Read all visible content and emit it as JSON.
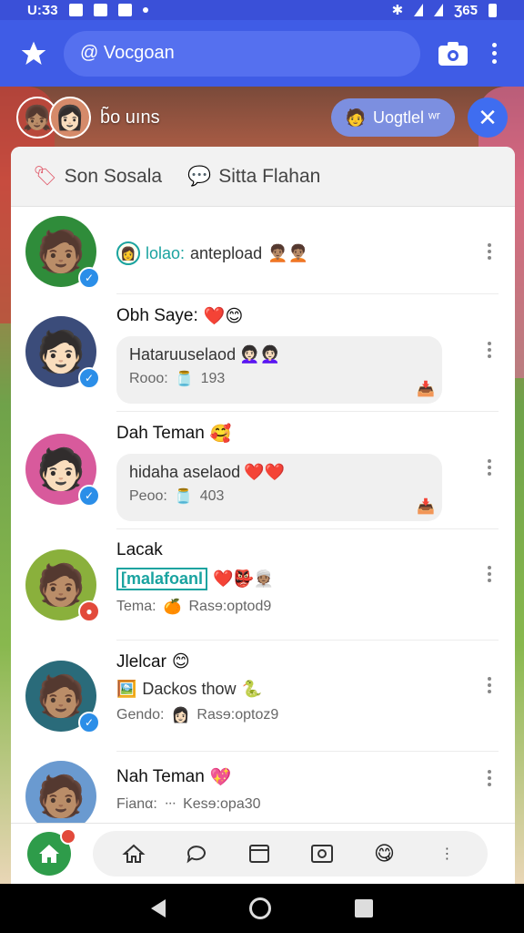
{
  "status_bar": {
    "time": "U:Ӡ3",
    "battery": "Ʒ6Ƽ"
  },
  "app_bar": {
    "search_text": "@ Vocgoan"
  },
  "sub_header": {
    "name": "b̃o uıns",
    "chip_label": "Uogtlel ʷʳ",
    "chip_emoji": "🧑"
  },
  "panel": {
    "title_left": "Son Sosala",
    "title_right": "Sitta Flahan"
  },
  "rows": [
    {
      "avatar": "🧑🏽",
      "avatar_bg": "#2f8c3a",
      "badge_color": "#2b8ee8",
      "line": "lolao:",
      "line_rest": "antepload",
      "emojis": "🧑🏽‍🦱🧑🏽‍🦱"
    },
    {
      "avatar": "🧑🏻",
      "avatar_bg": "#3b4c7a",
      "badge_color": "#2b8ee8",
      "name": "Obh Saye:",
      "name_emoji": "❤️😊",
      "bubble_l1": "Hataruuselaod",
      "bubble_l1_emoji": "👩🏻‍🦱👩🏻‍🦱",
      "bubble_l2_label": "Rooo:",
      "bubble_l2_value": "193",
      "bubble_l2_emoji": "🫙"
    },
    {
      "avatar": "🧑🏻",
      "avatar_bg": "#d85a9c",
      "badge_color": "#2b8ee8",
      "name": "Dah Teman",
      "name_emoji": "🥰",
      "bubble_l1": "hidaha aselaod",
      "bubble_l1_emoji": "❤️❤️",
      "bubble_l2_label": "Peoo:",
      "bubble_l2_value": "403",
      "bubble_l2_emoji": "🫙"
    },
    {
      "avatar": "🧑🏽",
      "avatar_bg": "#8ab03c",
      "badge_color": "#e24a3b",
      "name": "Lacak",
      "highlight": "[malafoanl",
      "line_emoji": "❤️👺👳🏽",
      "sub_label": "Tema:",
      "sub_value": "Rasɘ:optod9",
      "sub_emoji": "🍊"
    },
    {
      "avatar": "🧑🏽",
      "avatar_bg": "#2a6b7a",
      "badge_color": "#2b8ee8",
      "name": "Jlelcar",
      "name_emoji": "😊",
      "line_emoji_pre": "🖼️",
      "line": "Dackos thow",
      "line_emoji": "🐍",
      "sub_label": "Gendo:",
      "sub_value": "Rasɘ:optoz9",
      "sub_emoji": "👩🏻"
    },
    {
      "avatar": "🧑🏽",
      "avatar_bg": "#6a9ad0",
      "badge_color": "#2b8ee8",
      "name": "Nah Teman",
      "name_emoji": "💖",
      "sub_label": "Fianα:",
      "sub_value": "Kesɘ:opa30",
      "sub_emoji": "ᐧᐧᐧ"
    }
  ],
  "colors": {
    "primary": "#3f5ce6",
    "accent": "#2b8ee8",
    "teal": "#1aa3a0",
    "alert": "#e24a3b"
  }
}
